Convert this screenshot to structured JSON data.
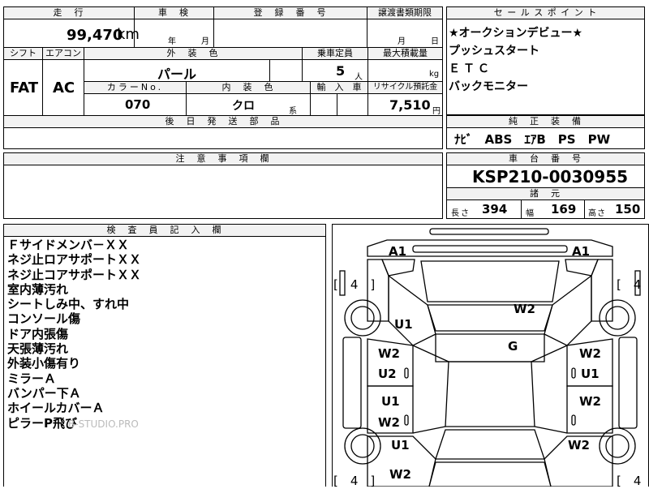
{
  "top": {
    "mileage_header": "走　行",
    "inspection_header": "車　検",
    "registration_header": "登　録　番　号",
    "transfer_header": "譲渡書類期限",
    "mileage_value": "99,470",
    "mileage_unit": "km",
    "inspection_year": "年",
    "inspection_month": "月",
    "transfer_month": "月",
    "transfer_day": "日",
    "shift_header": "シフト",
    "aircon_header": "エアコン",
    "exterior_header": "外　装　色",
    "capacity_header": "乗車定員",
    "maxload_header": "最大積載量",
    "shift_value": "FAT",
    "aircon_value": "AC",
    "exterior_value": "パール",
    "capacity_value": "5",
    "capacity_unit": "人",
    "maxload_unit": "kg",
    "color_no_header": "カラーNo.",
    "interior_header": "内　装　色",
    "import_header": "輸　入　車",
    "recycle_header": "リサイクル預託金",
    "color_no_value": "070",
    "interior_value": "クロ",
    "interior_unit": "系",
    "recycle_value": "7,510",
    "recycle_unit": "円",
    "later_parts_header": "後　日　発　送　部　品"
  },
  "sales": {
    "header": "セ ー ル ス ポ イ ン ト",
    "points": [
      "★オークションデビュー★",
      "プッシュスタート",
      "ＥＴＣ",
      "バックモニター"
    ]
  },
  "equipment": {
    "header": "純　正　装　備",
    "value": "ﾅﾋﾞ　ABS　ｴｱB　PS　PW"
  },
  "caution": {
    "header": "注　意　事　項　欄"
  },
  "chassis": {
    "header": "車　台　番　号",
    "value": "KSP210-0030955",
    "spec_header": "諸　元",
    "length_label": "長さ",
    "length_value": "394",
    "width_label": "幅",
    "width_value": "169",
    "height_label": "高さ",
    "height_value": "150"
  },
  "inspector": {
    "header": "検　査　員　記　入　欄",
    "notes": [
      "Ｆサイドメンバ－ＸＸ",
      "ネジ止ロアサポートＸＸ",
      "ネジ止コアサポートＸＸ",
      "室内薄汚れ",
      "シートしみ中、すれ中",
      "コンソール傷",
      "ドア内張傷",
      "天張薄汚れ",
      "外装小傷有り",
      "ミラーＡ",
      "バンパー下Ａ",
      "ホイールカバーＡ",
      "ピラーP飛び"
    ]
  },
  "diagram": {
    "marks": {
      "a1_left": "A1",
      "a1_right": "A1",
      "w2_hood": "W2",
      "g_roof": "G",
      "u1_fender": "U1",
      "w2_fl_door": "W2",
      "u2_fl_door": "U2",
      "w2_fr_door": "W2",
      "u1_fr_door": "U1",
      "u1_rl_door": "U1",
      "w2_rl_door": "W2",
      "w2_rr_door": "W2",
      "u1_rear_fender": "U1",
      "w2_rear_fender": "W2",
      "w2_rear": "W2",
      "tire_fl": "[　4　]",
      "tire_fr": "[　4",
      "tire_rl": "[　4　]",
      "tire_rr": "[　4"
    }
  },
  "watermark": "B-STUDIO.PRO"
}
